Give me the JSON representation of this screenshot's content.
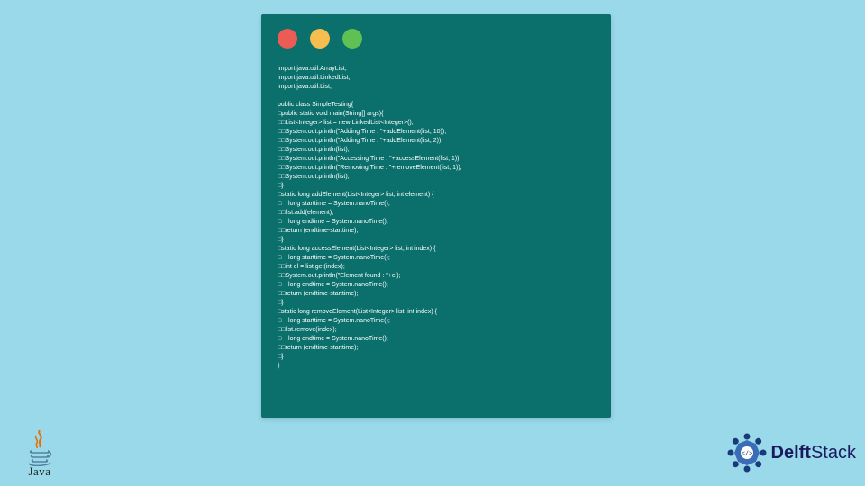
{
  "traffic": [
    "red",
    "yellow",
    "green"
  ],
  "code_lines": [
    "import java.util.ArrayList;",
    "import java.util.LinkedList;",
    "import java.util.List;",
    "",
    "public class SimpleTesting{",
    "□public static void main(String[] args){",
    "□□List<Integer> list = new LinkedList<Integer>();",
    "□□System.out.println(\"Adding Time : \"+addElement(list, 10));",
    "□□System.out.println(\"Adding Time : \"+addElement(list, 2));",
    "□□System.out.println(list);",
    "□□System.out.println(\"Accessing Time : \"+accessElement(list, 1));",
    "□□System.out.println(\"Removing Time : \"+removeElement(list, 1));",
    "□□System.out.println(list);",
    "□}",
    "□static long addElement(List<Integer> list, int element) {",
    "□    long starttime = System.nanoTime();",
    "□□list.add(element);",
    "□    long endtime = System.nanoTime();",
    "□□return (endtime-starttime);",
    "□}",
    "□static long accessElement(List<Integer> list, int index) {",
    "□    long starttime = System.nanoTime();",
    "□□int el = list.get(index);",
    "□□System.out.println(\"Element found : \"+el);",
    "□    long endtime = System.nanoTime();",
    "□□return (endtime-starttime);",
    "□}",
    "□static long removeElement(List<Integer> list, int index) {",
    "□    long starttime = System.nanoTime();",
    "□□list.remove(index);",
    "□    long endtime = System.nanoTime();",
    "□□return (endtime-starttime);",
    "□}",
    "}"
  ],
  "java_label": "Java",
  "delft_label_a": "Delft",
  "delft_label_b": "Stack"
}
